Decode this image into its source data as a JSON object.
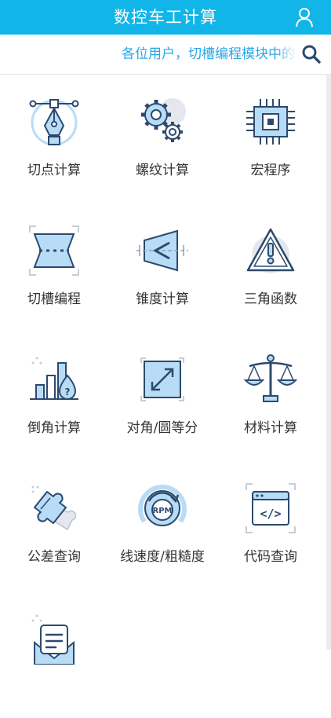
{
  "header": {
    "title": "数控车工计算"
  },
  "notice": {
    "text": "各位用户，切槽编程模块中的"
  },
  "grid": {
    "items": [
      {
        "label": "切点计算",
        "icon": "pen-tool-icon"
      },
      {
        "label": "螺纹计算",
        "icon": "gears-icon"
      },
      {
        "label": "宏程序",
        "icon": "chip-icon"
      },
      {
        "label": "切槽编程",
        "icon": "groove-icon"
      },
      {
        "label": "锥度计算",
        "icon": "taper-icon"
      },
      {
        "label": "三角函数",
        "icon": "warning-triangle-icon"
      },
      {
        "label": "倒角计算",
        "icon": "bar-chart-drop-icon"
      },
      {
        "label": "对角/圆等分",
        "icon": "diagonal-arrows-icon"
      },
      {
        "label": "材料计算",
        "icon": "scale-icon"
      },
      {
        "label": "公差查询",
        "icon": "puzzle-icon"
      },
      {
        "label": "线速度/粗糙度",
        "icon": "rpm-icon"
      },
      {
        "label": "代码查询",
        "icon": "code-window-icon"
      },
      {
        "label": "",
        "icon": "document-envelope-icon"
      }
    ]
  },
  "colors": {
    "header": "#12b5e8",
    "accent": "#2aa6e6",
    "icon_fill": "#b8dcf5",
    "icon_stroke": "#2c4a6e"
  }
}
